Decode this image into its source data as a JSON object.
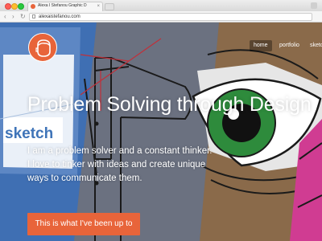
{
  "browser": {
    "tab_title": "Alexa I Stefanou Graphic D",
    "tab_close": "×",
    "back_glyph": "‹",
    "forward_glyph": "›",
    "reload_glyph": "↻",
    "url": "alexaistefanou.com"
  },
  "site": {
    "nav": {
      "items": [
        "home",
        "portfolio",
        "sketch"
      ],
      "active": "home"
    },
    "hero": {
      "headline": "Problem Solving through Design",
      "intro_lines": [
        "I am a problem solver and a constant thinker.",
        "I love to tinker with ideas and create unique",
        "ways to communicate them."
      ],
      "cta_label": "This is what I've been up to",
      "background_sketch_text": "sketch"
    },
    "colors": {
      "accent": "#e8643a",
      "panel_blue": "#3f6fb3",
      "panel_grey": "#6b7180",
      "panel_tan": "#8a6a4a",
      "panel_magenta": "#d03c92",
      "eye_green": "#2e8b3c"
    }
  }
}
